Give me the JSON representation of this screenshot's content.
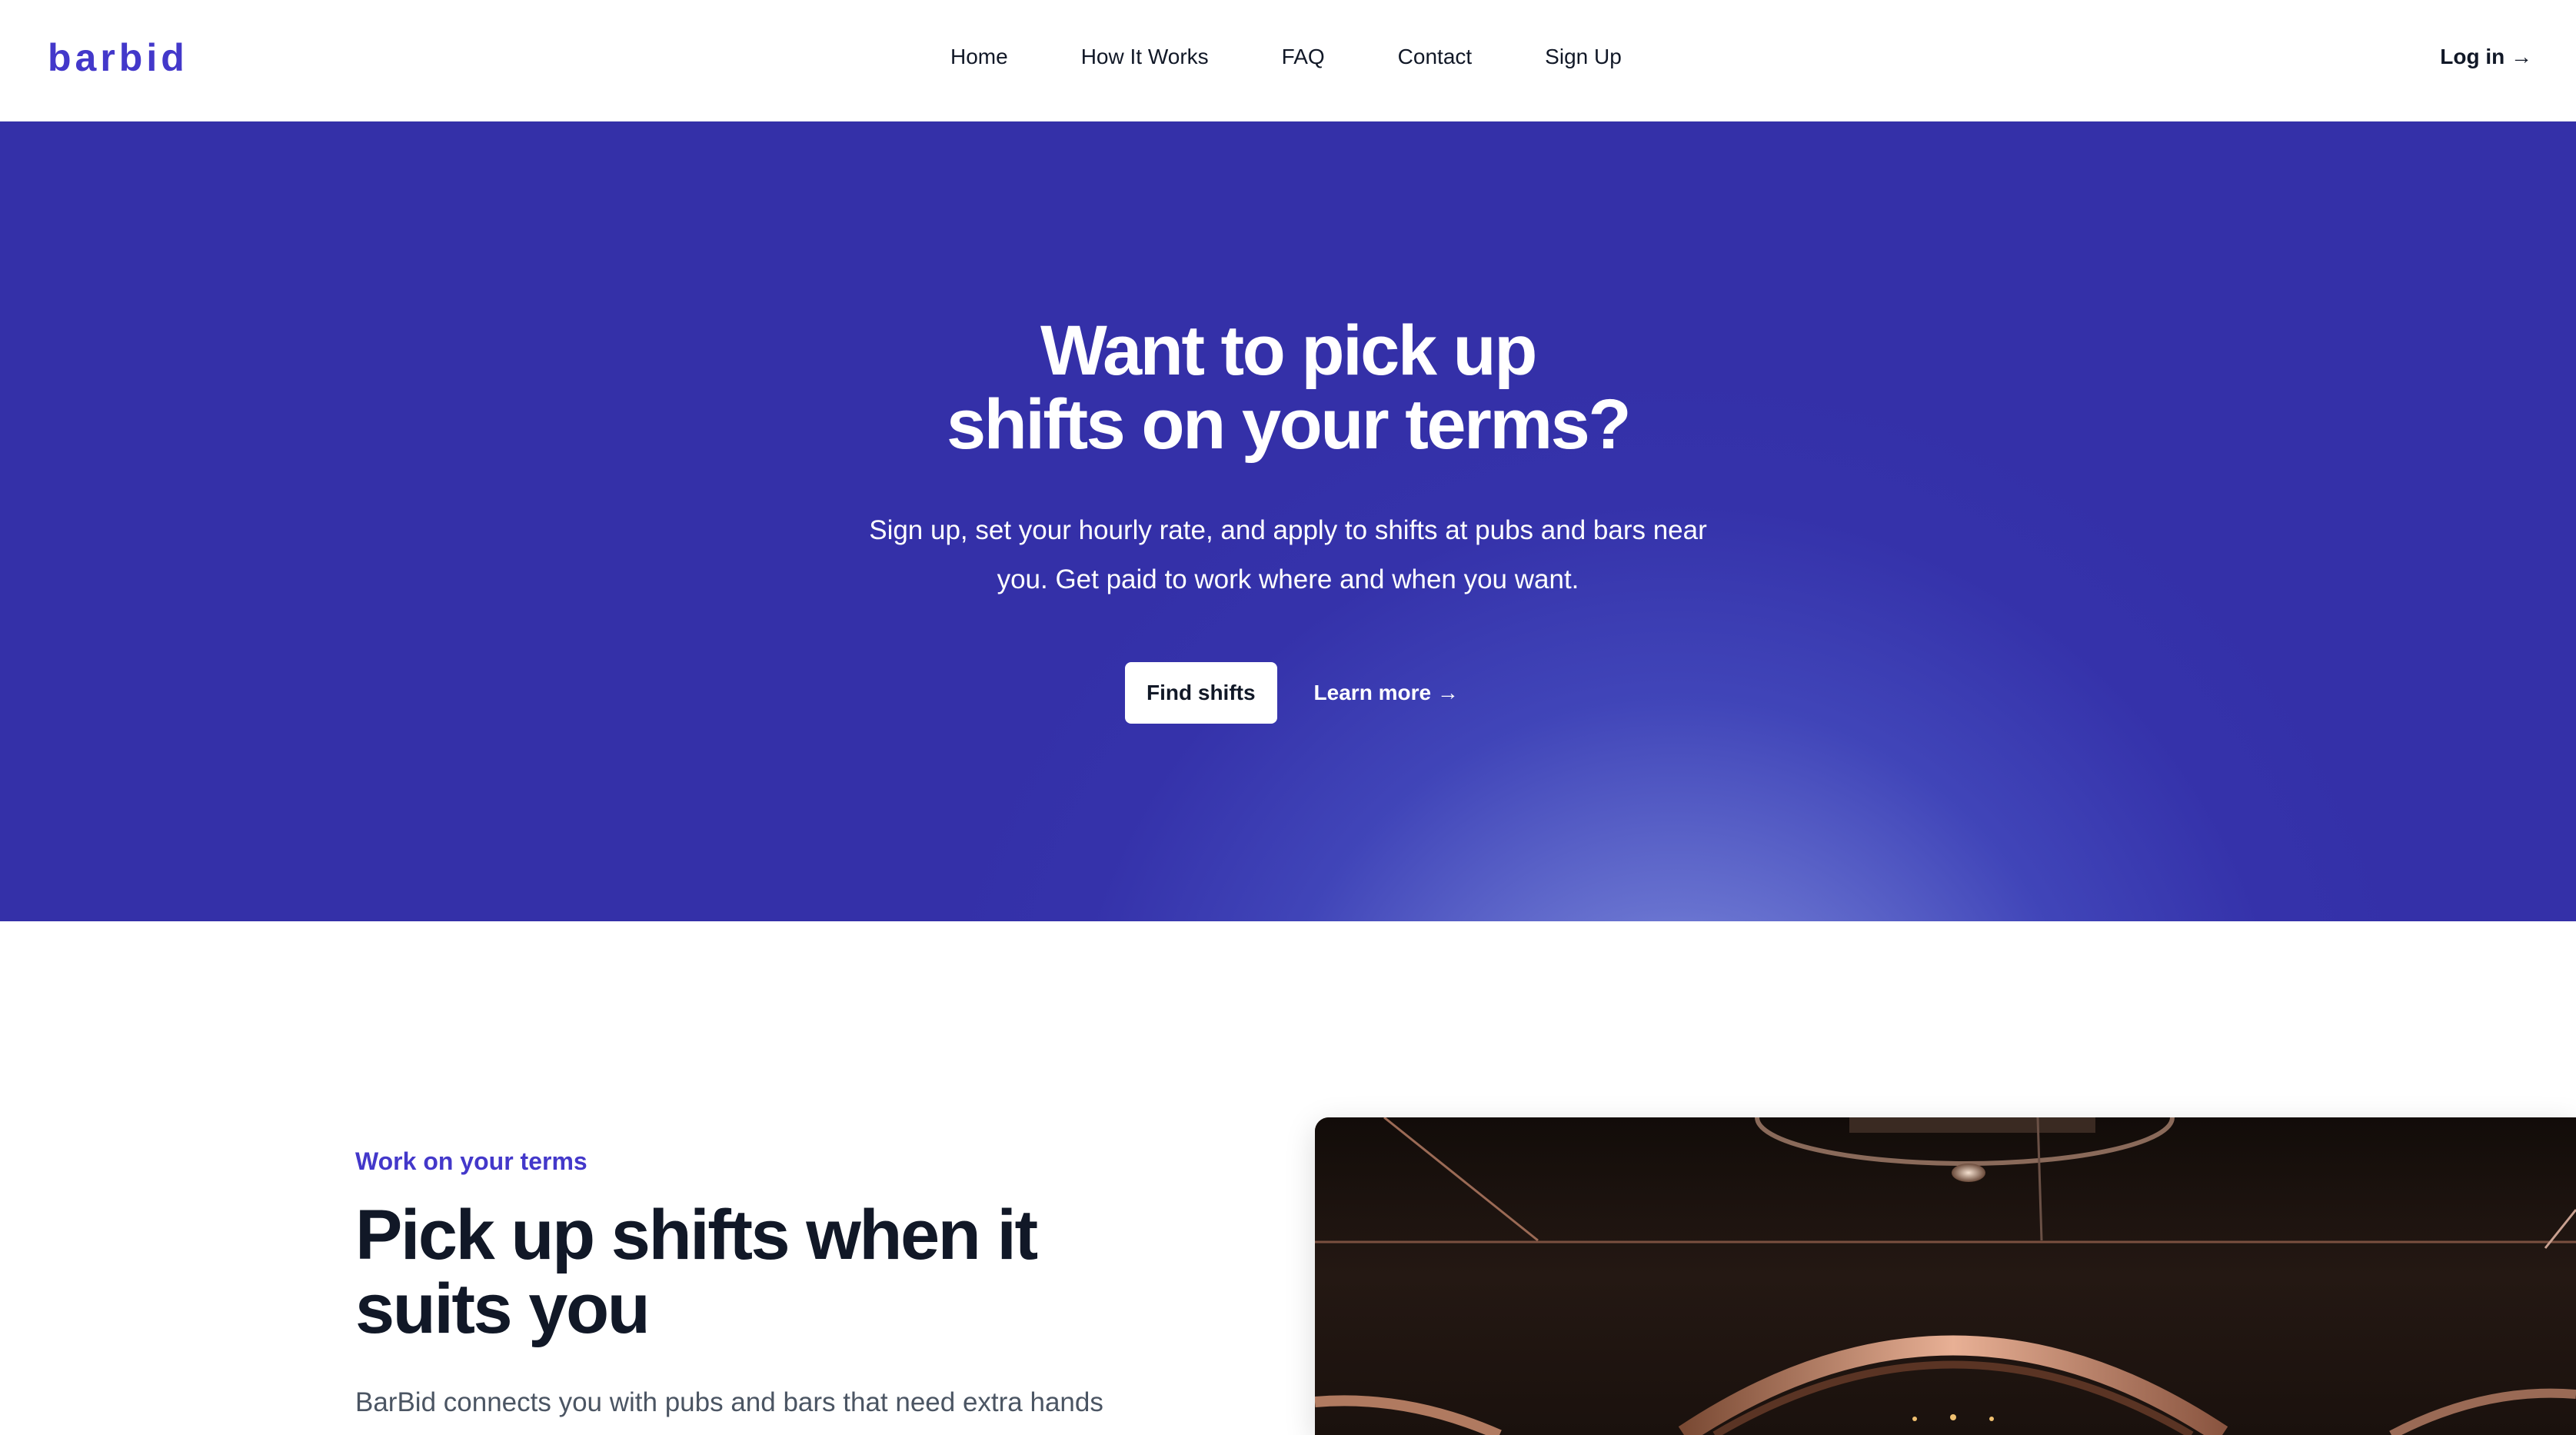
{
  "nav": {
    "logo": "barbid",
    "links": [
      "Home",
      "How It Works",
      "FAQ",
      "Contact",
      "Sign Up"
    ],
    "login": "Log in →"
  },
  "hero": {
    "title_line1": "Want to pick up",
    "title_line2": "shifts on your terms?",
    "subtitle": "Sign up, set your hourly rate, and apply to shifts at pubs and bars near you. Get paid to work where and when you want.",
    "primary_button": "Find shifts",
    "secondary_link": "Learn more →"
  },
  "feature": {
    "eyebrow": "Work on your terms",
    "title": "Pick up shifts when it suits you",
    "text": "BarBid connects you with pubs and bars that need extra hands"
  },
  "colors": {
    "brand": "#4338ca",
    "hero_bg": "#3430a8",
    "text": "#111827"
  }
}
